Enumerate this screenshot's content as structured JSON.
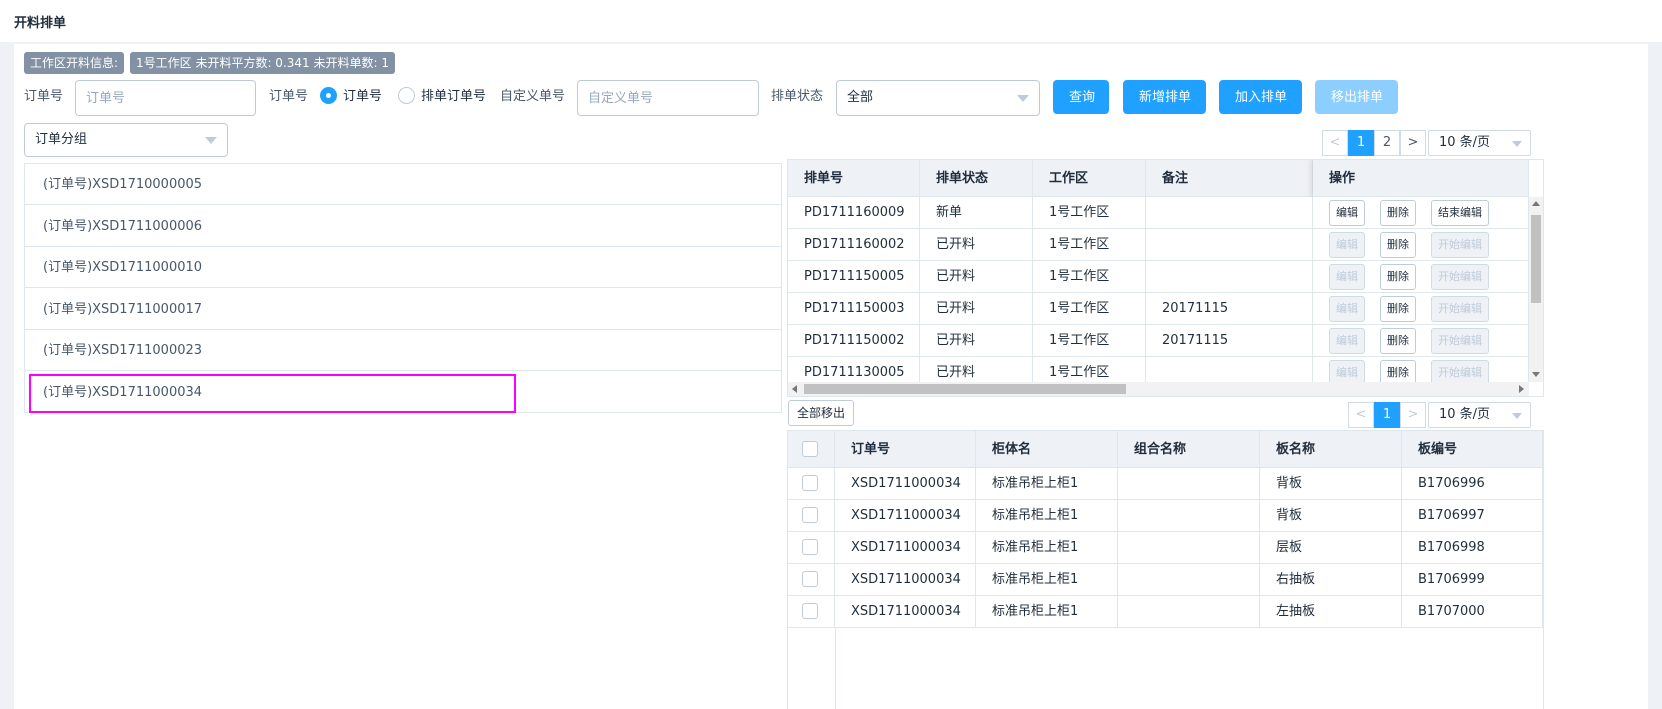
{
  "page": {
    "title": "开料排单"
  },
  "info": {
    "label": "工作区开料信息:",
    "summary": "1号工作区 未开料平方数: 0.341 未开料单数: 1"
  },
  "filters": {
    "order_no_label": "订单号",
    "order_no_placeholder": "订单号",
    "type_label": "订单号",
    "radio_order": "订单号",
    "radio_schedule": "排单订单号",
    "custom_label": "自定义单号",
    "custom_placeholder": "自定义单号",
    "status_label": "排单状态",
    "status_value": "全部",
    "group_value": "订单分组"
  },
  "buttons": {
    "query": "查询",
    "add_schedule": "新增排单",
    "join_schedule": "加入排单",
    "remove_schedule": "移出排单",
    "remove_all": "全部移出"
  },
  "order_list": [
    "(订单号)XSD1710000005",
    "(订单号)XSD1711000006",
    "(订单号)XSD1711000010",
    "(订单号)XSD1711000017",
    "(订单号)XSD1711000023",
    "(订单号)XSD1711000034"
  ],
  "top_pager": {
    "prev": "<",
    "pages": [
      "1",
      "2"
    ],
    "next": ">",
    "size": "10 条/页"
  },
  "schedule_table": {
    "headers": [
      "排单号",
      "排单状态",
      "工作区",
      "备注",
      "操作"
    ],
    "rows": [
      {
        "no": "PD1711160009",
        "status": "新单",
        "area": "1号工作区",
        "remark": "",
        "edit": "编辑",
        "delete": "删除",
        "toggle": "结束编辑"
      },
      {
        "no": "PD1711160002",
        "status": "已开料",
        "area": "1号工作区",
        "remark": "",
        "edit": "编辑",
        "delete": "删除",
        "toggle": "开始编辑"
      },
      {
        "no": "PD1711150005",
        "status": "已开料",
        "area": "1号工作区",
        "remark": "",
        "edit": "编辑",
        "delete": "删除",
        "toggle": "开始编辑"
      },
      {
        "no": "PD1711150003",
        "status": "已开料",
        "area": "1号工作区",
        "remark": "20171115",
        "edit": "编辑",
        "delete": "删除",
        "toggle": "开始编辑"
      },
      {
        "no": "PD1711150002",
        "status": "已开料",
        "area": "1号工作区",
        "remark": "20171115",
        "edit": "编辑",
        "delete": "删除",
        "toggle": "开始编辑"
      },
      {
        "no": "PD1711130005",
        "status": "已开料",
        "area": "1号工作区",
        "remark": "",
        "edit": "编辑",
        "delete": "删除",
        "toggle": "开始编辑"
      }
    ]
  },
  "bottom_pager": {
    "prev": "<",
    "pages": [
      "1"
    ],
    "next": ">",
    "size": "10 条/页"
  },
  "board_table": {
    "headers": [
      "订单号",
      "柜体名",
      "组合名称",
      "板名称",
      "板编号"
    ],
    "rows": [
      {
        "order": "XSD1711000034",
        "cabinet": "标准吊柜上柜1",
        "combo": "",
        "board": "背板",
        "code": "B1706996"
      },
      {
        "order": "XSD1711000034",
        "cabinet": "标准吊柜上柜1",
        "combo": "",
        "board": "背板",
        "code": "B1706997"
      },
      {
        "order": "XSD1711000034",
        "cabinet": "标准吊柜上柜1",
        "combo": "",
        "board": "层板",
        "code": "B1706998"
      },
      {
        "order": "XSD1711000034",
        "cabinet": "标准吊柜上柜1",
        "combo": "",
        "board": "右抽板",
        "code": "B1706999"
      },
      {
        "order": "XSD1711000034",
        "cabinet": "标准吊柜上柜1",
        "combo": "",
        "board": "左抽板",
        "code": "B1707000"
      }
    ]
  },
  "colors": {
    "primary": "#20a0ff",
    "primary_disabled": "#8ccfff",
    "highlight": "#ff00ff",
    "tag": "#8391a5"
  },
  "icons": {
    "caret": "caret-down-icon",
    "radio": "radio-icon",
    "checkbox": "checkbox-icon"
  }
}
